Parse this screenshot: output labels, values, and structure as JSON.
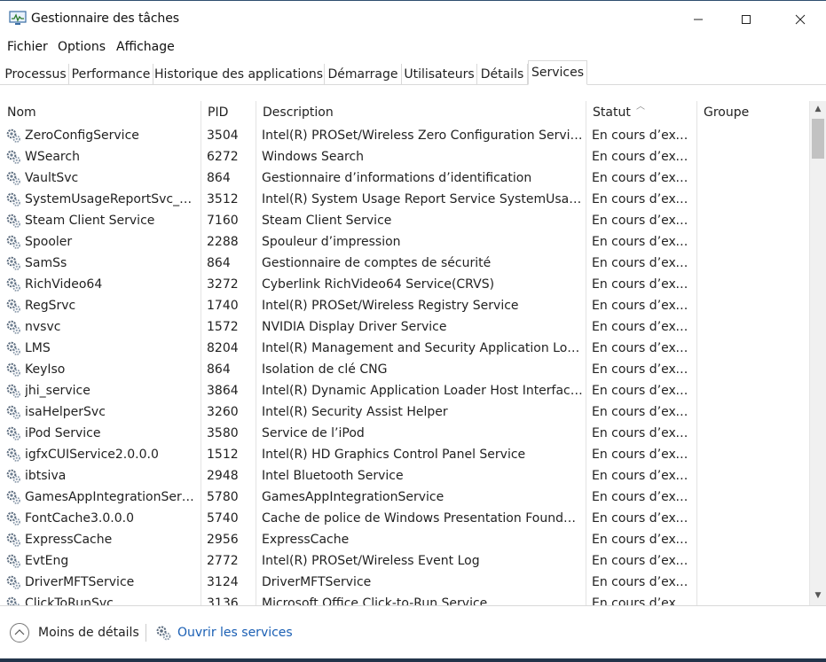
{
  "window": {
    "title": "Gestionnaire des tâches"
  },
  "menu": [
    "Fichier",
    "Options",
    "Affichage"
  ],
  "tabs": [
    "Processus",
    "Performance",
    "Historique des applications",
    "Démarrage",
    "Utilisateurs",
    "Détails",
    "Services"
  ],
  "active_tab": "Services",
  "columns": {
    "name": "Nom",
    "pid": "PID",
    "description": "Description",
    "status": "Statut",
    "group": "Groupe"
  },
  "services": [
    {
      "name": "ZeroConfigService",
      "pid": "3504",
      "description": "Intel(R) PROSet/Wireless Zero Configuration Service",
      "status": "En cours d’exéc...",
      "group": ""
    },
    {
      "name": "WSearch",
      "pid": "6272",
      "description": "Windows Search",
      "status": "En cours d’exéc...",
      "group": ""
    },
    {
      "name": "VaultSvc",
      "pid": "864",
      "description": "Gestionnaire d’informations d’identification",
      "status": "En cours d’exéc...",
      "group": ""
    },
    {
      "name": "SystemUsageReportSvc_QU...",
      "pid": "3512",
      "description": "Intel(R) System Usage Report Service SystemUsageR...",
      "status": "En cours d’exéc...",
      "group": ""
    },
    {
      "name": "Steam Client Service",
      "pid": "7160",
      "description": "Steam Client Service",
      "status": "En cours d’exéc...",
      "group": ""
    },
    {
      "name": "Spooler",
      "pid": "2288",
      "description": "Spouleur d’impression",
      "status": "En cours d’exéc...",
      "group": ""
    },
    {
      "name": "SamSs",
      "pid": "864",
      "description": "Gestionnaire de comptes de sécurité",
      "status": "En cours d’exéc...",
      "group": ""
    },
    {
      "name": "RichVideo64",
      "pid": "3272",
      "description": "Cyberlink RichVideo64 Service(CRVS)",
      "status": "En cours d’exéc...",
      "group": ""
    },
    {
      "name": "RegSrvc",
      "pid": "1740",
      "description": "Intel(R) PROSet/Wireless Registry Service",
      "status": "En cours d’exéc...",
      "group": ""
    },
    {
      "name": "nvsvc",
      "pid": "1572",
      "description": "NVIDIA Display Driver Service",
      "status": "En cours d’exéc...",
      "group": ""
    },
    {
      "name": "LMS",
      "pid": "8204",
      "description": "Intel(R) Management and Security Application Local ...",
      "status": "En cours d’exéc...",
      "group": ""
    },
    {
      "name": "KeyIso",
      "pid": "864",
      "description": "Isolation de clé CNG",
      "status": "En cours d’exéc...",
      "group": ""
    },
    {
      "name": "jhi_service",
      "pid": "3864",
      "description": "Intel(R) Dynamic Application Loader Host Interface ...",
      "status": "En cours d’exéc...",
      "group": ""
    },
    {
      "name": "isaHelperSvc",
      "pid": "3260",
      "description": "Intel(R) Security Assist Helper",
      "status": "En cours d’exéc...",
      "group": ""
    },
    {
      "name": "iPod Service",
      "pid": "3580",
      "description": "Service de l’iPod",
      "status": "En cours d’exéc...",
      "group": ""
    },
    {
      "name": "igfxCUIService2.0.0.0",
      "pid": "1512",
      "description": "Intel(R) HD Graphics Control Panel Service",
      "status": "En cours d’exéc...",
      "group": ""
    },
    {
      "name": "ibtsiva",
      "pid": "2948",
      "description": "Intel Bluetooth Service",
      "status": "En cours d’exéc...",
      "group": ""
    },
    {
      "name": "GamesAppIntegrationService",
      "pid": "5780",
      "description": "GamesAppIntegrationService",
      "status": "En cours d’exéc...",
      "group": ""
    },
    {
      "name": "FontCache3.0.0.0",
      "pid": "5740",
      "description": "Cache de police de Windows Presentation Foundatio...",
      "status": "En cours d’exéc...",
      "group": ""
    },
    {
      "name": "ExpressCache",
      "pid": "2956",
      "description": "ExpressCache",
      "status": "En cours d’exéc...",
      "group": ""
    },
    {
      "name": "EvtEng",
      "pid": "2772",
      "description": "Intel(R) PROSet/Wireless Event Log",
      "status": "En cours d’exéc...",
      "group": ""
    },
    {
      "name": "DriverMFTService",
      "pid": "3124",
      "description": "DriverMFTService",
      "status": "En cours d’exéc...",
      "group": ""
    },
    {
      "name": "ClickToRunSvc",
      "pid": "3136",
      "description": "Microsoft Office Click-to-Run Service",
      "status": "En cours d’exéc...",
      "group": ""
    }
  ],
  "footer": {
    "less_details": "Moins de détails",
    "open_services": "Ouvrir les services"
  },
  "colors": {
    "link": "#1a5fb4",
    "border": "#d9d9d9",
    "scroll_thumb": "#c2c2c2"
  },
  "icons": {
    "app": "task-manager-icon",
    "service": "service-gears-icon",
    "less_details": "chevron-up-circle-icon",
    "open_services": "services-gears-icon"
  }
}
